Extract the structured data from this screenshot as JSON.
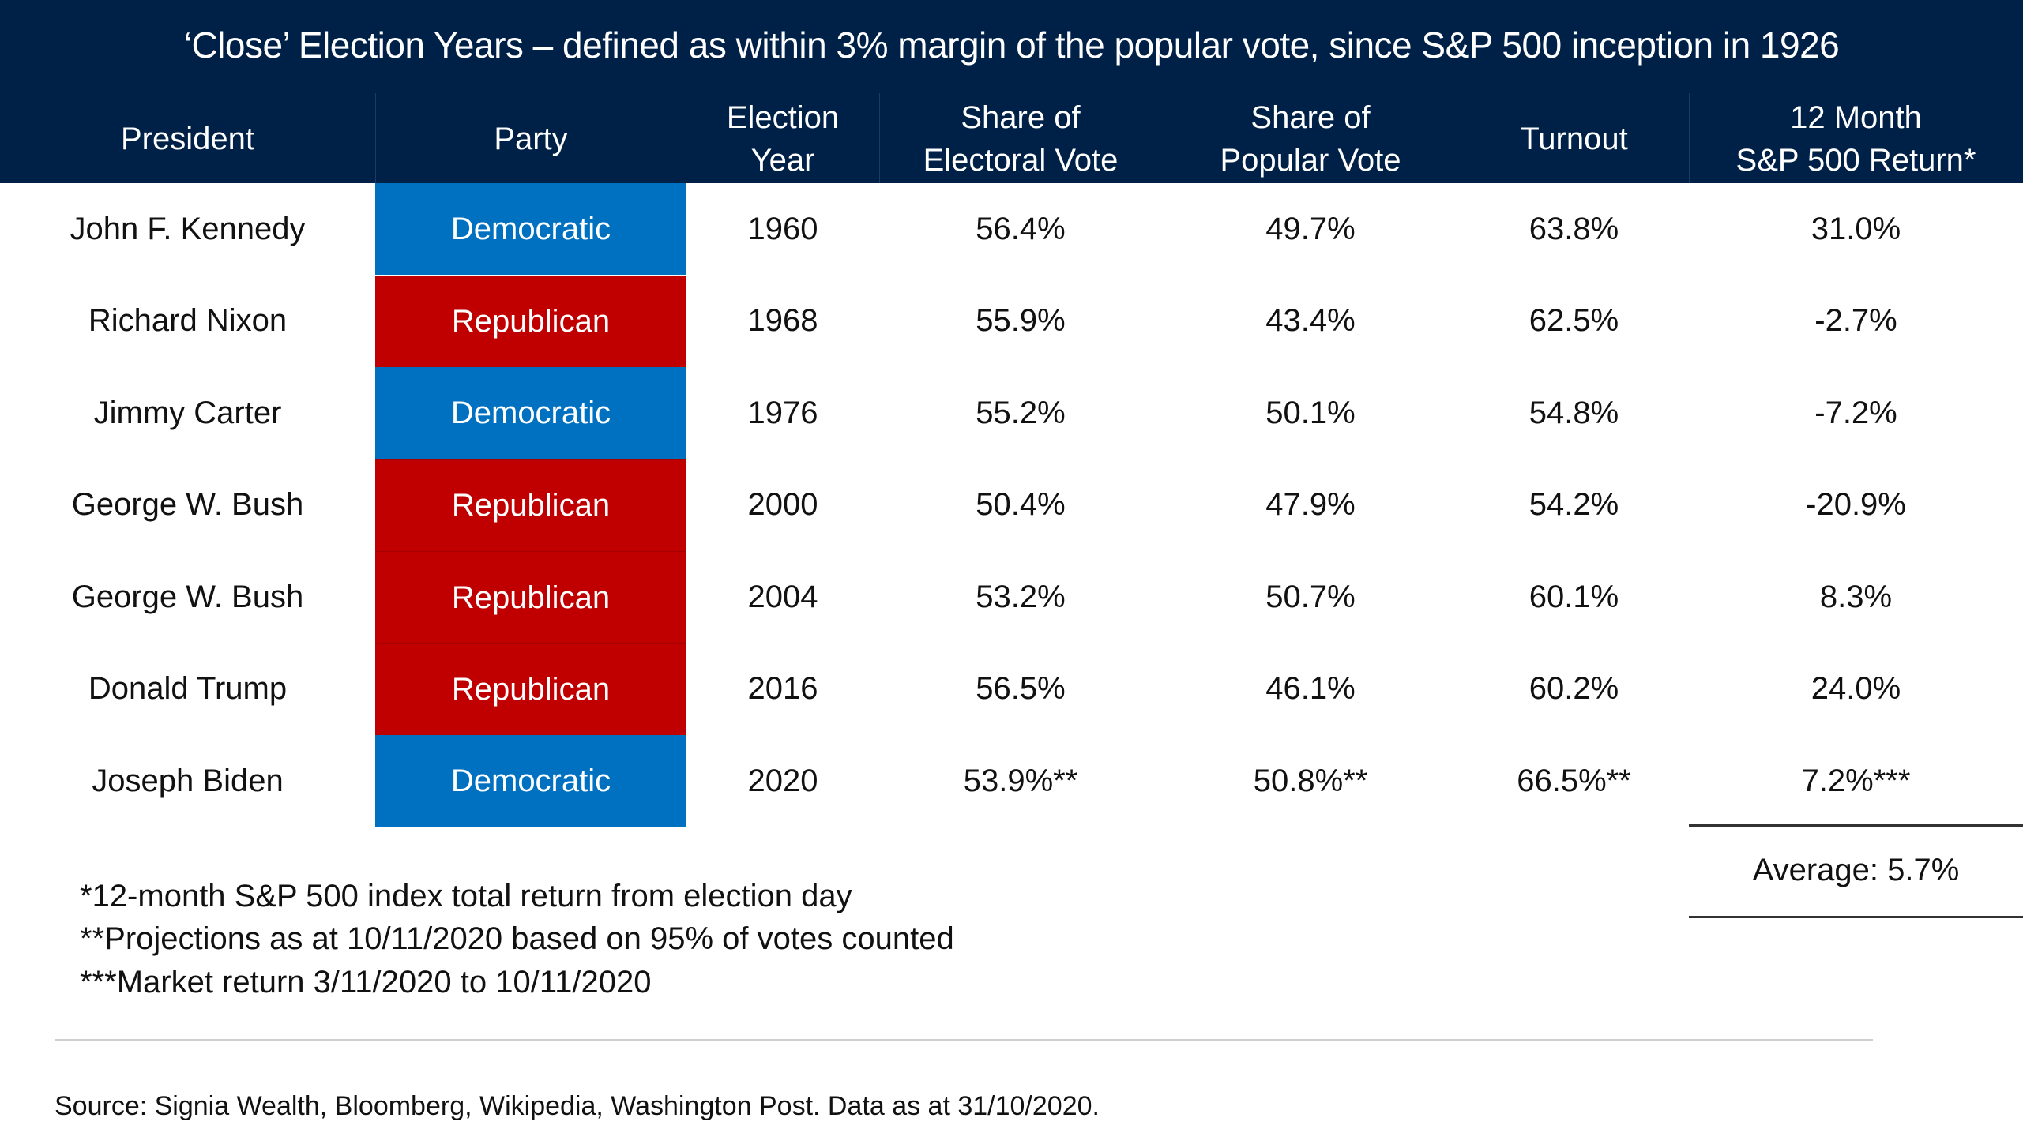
{
  "title": "‘Close’ Election Years – defined as within 3% margin of the popular vote, since S&P 500 inception in 1926",
  "columns": [
    {
      "key": "president",
      "label": "President"
    },
    {
      "key": "party",
      "label": "Party"
    },
    {
      "key": "year",
      "label": "Election\nYear"
    },
    {
      "key": "electoral",
      "label": "Share of\nElectoral Vote"
    },
    {
      "key": "popular",
      "label": "Share of\nPopular Vote"
    },
    {
      "key": "turnout",
      "label": "Turnout"
    },
    {
      "key": "return",
      "label": "12 Month\nS&P 500 Return*"
    }
  ],
  "colors": {
    "header_bg": "#002147",
    "democratic": "#0070c0",
    "republican": "#c00000"
  },
  "rows": [
    {
      "president": "John F. Kennedy",
      "party": "Democratic",
      "year": "1960",
      "electoral": "56.4%",
      "popular": "49.7%",
      "turnout": "63.8%",
      "return": "31.0%"
    },
    {
      "president": "Richard Nixon",
      "party": "Republican",
      "year": "1968",
      "electoral": "55.9%",
      "popular": "43.4%",
      "turnout": "62.5%",
      "return": "-2.7%"
    },
    {
      "president": "Jimmy Carter",
      "party": "Democratic",
      "year": "1976",
      "electoral": "55.2%",
      "popular": "50.1%",
      "turnout": "54.8%",
      "return": "-7.2%"
    },
    {
      "president": "George W. Bush",
      "party": "Republican",
      "year": "2000",
      "electoral": "50.4%",
      "popular": "47.9%",
      "turnout": "54.2%",
      "return": "-20.9%"
    },
    {
      "president": "George W. Bush",
      "party": "Republican",
      "year": "2004",
      "electoral": "53.2%",
      "popular": "50.7%",
      "turnout": "60.1%",
      "return": "8.3%"
    },
    {
      "president": "Donald Trump",
      "party": "Republican",
      "year": "2016",
      "electoral": "56.5%",
      "popular": "46.1%",
      "turnout": "60.2%",
      "return": "24.0%"
    },
    {
      "president": "Joseph Biden",
      "party": "Democratic",
      "year": "2020",
      "electoral": "53.9%**",
      "popular": "50.8%**",
      "turnout": "66.5%**",
      "return": "7.2%***"
    }
  ],
  "average": "Average: 5.7%",
  "footnotes": [
    "*12-month S&P 500 index total return from election day",
    "**Projections as at 10/11/2020 based on 95% of votes counted",
    "***Market return 3/11/2020 to 10/11/2020"
  ],
  "source": "Source: Signia Wealth, Bloomberg, Wikipedia, Washington Post. Data as at 31/10/2020."
}
